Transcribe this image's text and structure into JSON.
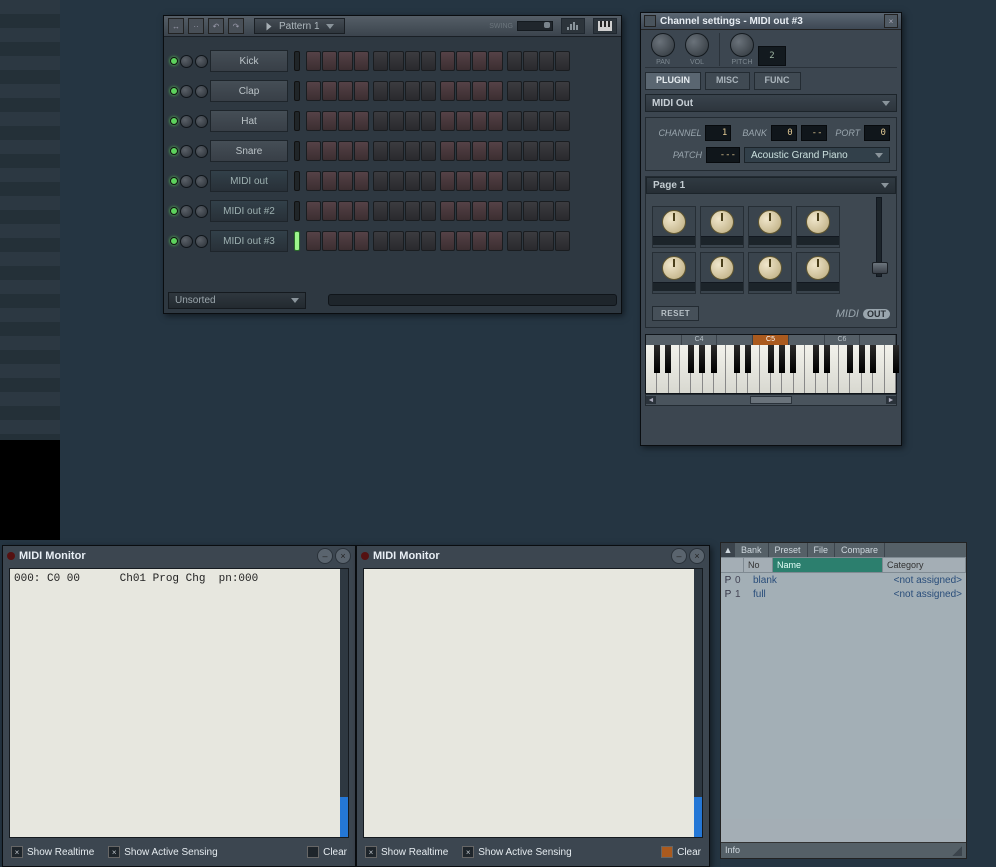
{
  "sequencer": {
    "pattern_label": "Pattern 1",
    "swing_label": "SWING",
    "category": "Unsorted",
    "channels": [
      {
        "name": "Kick",
        "midi": false
      },
      {
        "name": "Clap",
        "midi": false
      },
      {
        "name": "Hat",
        "midi": false
      },
      {
        "name": "Snare",
        "midi": false
      },
      {
        "name": "MIDI out",
        "midi": true
      },
      {
        "name": "MIDI out #2",
        "midi": true
      },
      {
        "name": "MIDI out #3",
        "midi": true
      }
    ]
  },
  "channel_settings": {
    "title": "Channel settings - MIDI out #3",
    "knobs_top": [
      {
        "label": "PAN"
      },
      {
        "label": "VOL"
      },
      {
        "label": "PITCH"
      }
    ],
    "tabs": [
      "PLUGIN",
      "MISC",
      "FUNC"
    ],
    "active_tab": 0,
    "plugin_name": "MIDI Out",
    "fields": {
      "channel_label": "CHANNEL",
      "channel_val": "1",
      "bank_label": "BANK",
      "bank_val1": "0",
      "bank_val2": "--",
      "port_label": "PORT",
      "port_val": "0",
      "patch_label": "PATCH",
      "patch_num": "---",
      "patch_name": "Acoustic Grand Piano"
    },
    "page_label": "Page 1",
    "reset_label": "RESET",
    "logo_midi": "MIDI",
    "logo_out": "OUT",
    "octave_labels": [
      "",
      "C4",
      "",
      "C5",
      "",
      "C6",
      ""
    ]
  },
  "midi_monitor_1": {
    "title": "MIDI Monitor",
    "log_line": "000: C0 00      Ch01 Prog Chg  pn:000",
    "show_realtime": "Show Realtime",
    "show_as": "Show Active Sensing",
    "clear": "Clear",
    "realtime_checked": true,
    "as_checked": true,
    "clear_checked": false
  },
  "midi_monitor_2": {
    "title": "MIDI Monitor",
    "show_realtime": "Show Realtime",
    "show_as": "Show Active Sensing",
    "clear": "Clear",
    "realtime_checked": true,
    "as_checked": true,
    "clear_checked": false,
    "clear_color": "orange"
  },
  "browser": {
    "tabs": [
      "Bank",
      "Preset",
      "File",
      "Compare"
    ],
    "col_no": "No",
    "col_name": "Name",
    "col_cat": "Category",
    "rows": [
      {
        "p": "P",
        "no": "0",
        "name": "blank",
        "cat": "<not assigned>"
      },
      {
        "p": "P",
        "no": "1",
        "name": "full",
        "cat": "<not assigned>"
      }
    ],
    "info_label": "Info"
  }
}
